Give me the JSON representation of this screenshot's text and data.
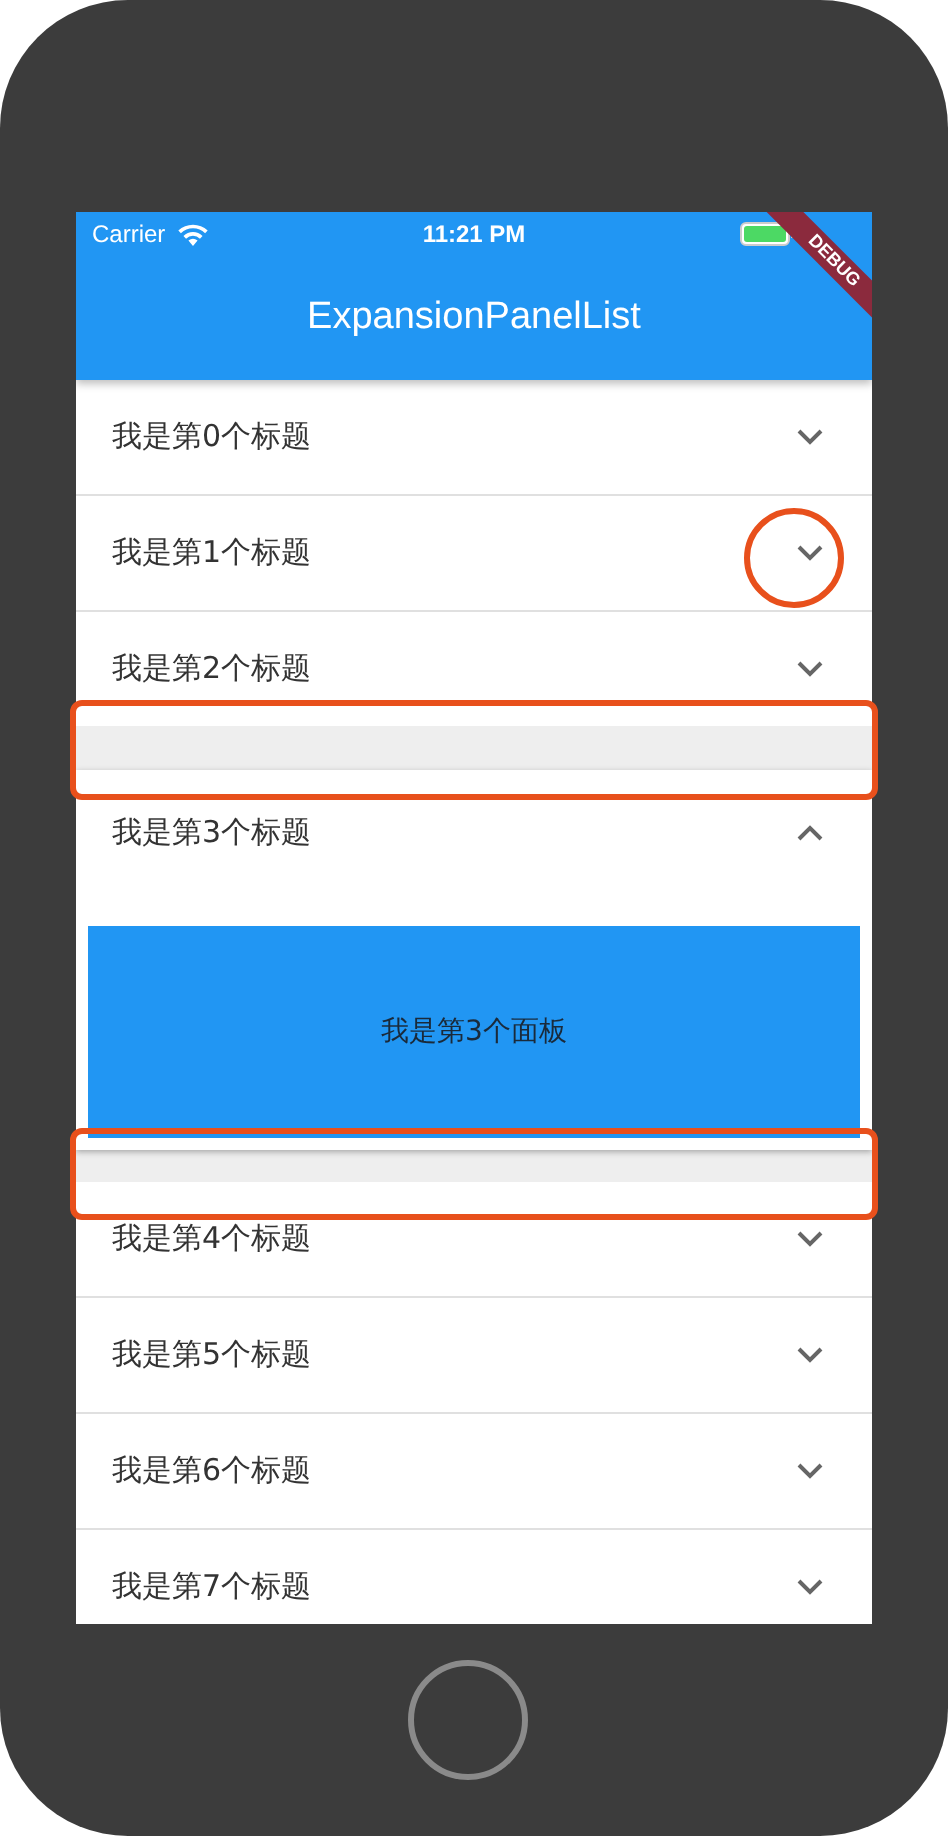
{
  "status_bar": {
    "carrier": "Carrier",
    "time": "11:21 PM"
  },
  "debug_banner": "DEBUG",
  "app_bar": {
    "title": "ExpansionPanelList"
  },
  "panels": [
    {
      "title": "我是第0个标题",
      "expanded": false
    },
    {
      "title": "我是第1个标题",
      "expanded": false
    },
    {
      "title": "我是第2个标题",
      "expanded": false
    },
    {
      "title": "我是第3个标题",
      "expanded": true,
      "body": "我是第3个面板"
    },
    {
      "title": "我是第4个标题",
      "expanded": false
    },
    {
      "title": "我是第5个标题",
      "expanded": false
    },
    {
      "title": "我是第6个标题",
      "expanded": false
    },
    {
      "title": "我是第7个标题",
      "expanded": false
    }
  ]
}
